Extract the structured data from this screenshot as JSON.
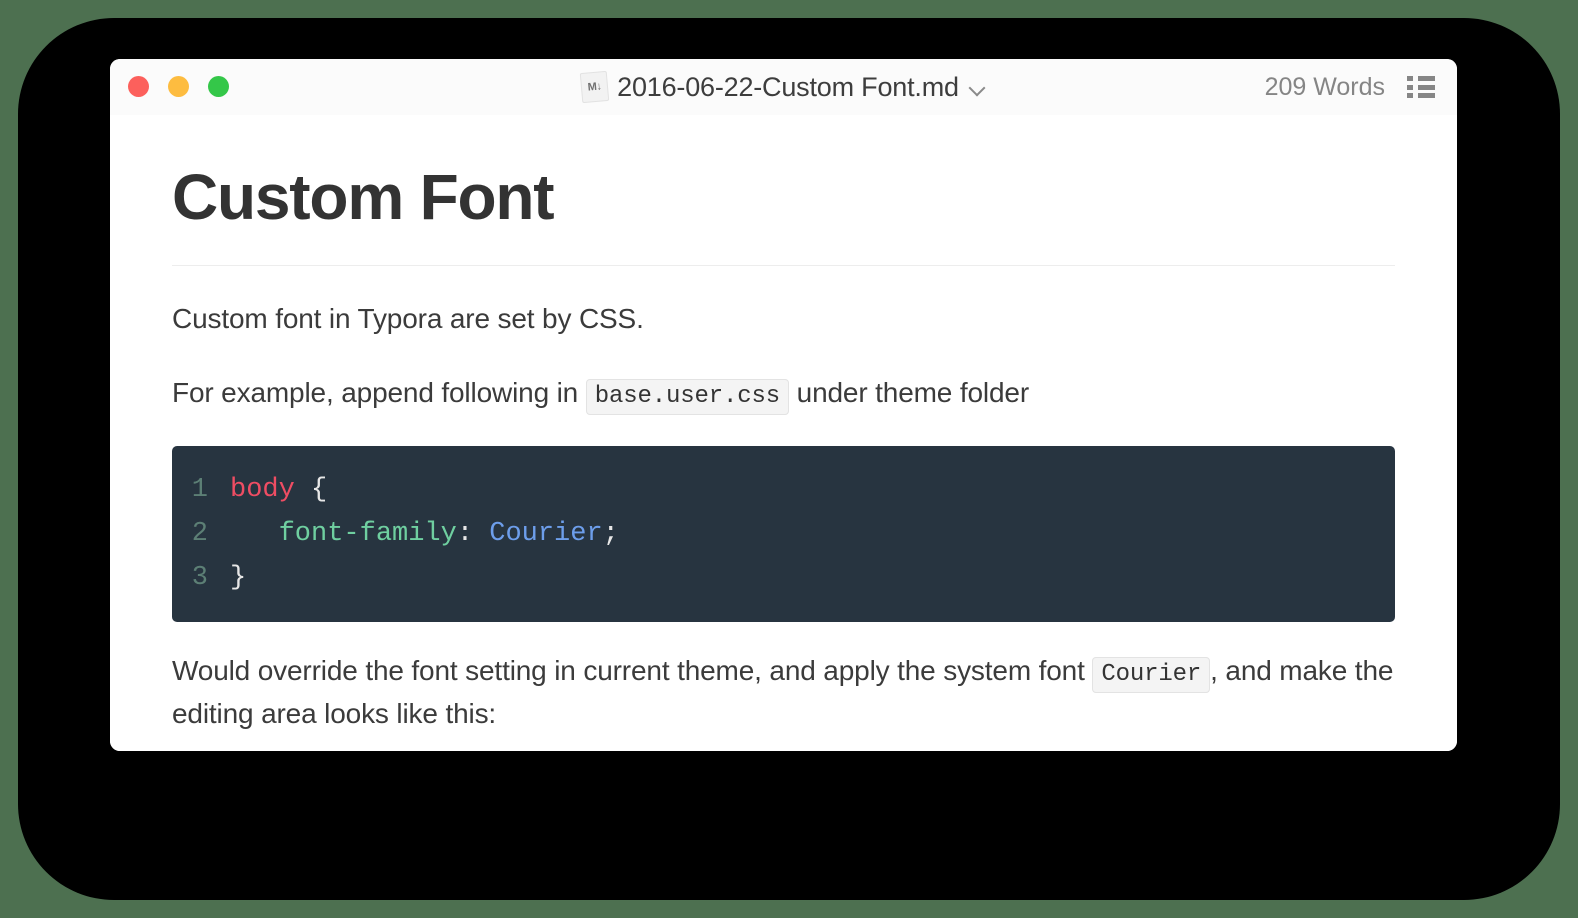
{
  "window": {
    "background_color": "#4d7050",
    "chrome_color": "#000000",
    "surface_color": "#ffffff"
  },
  "title_bar": {
    "traffic_lights": [
      {
        "name": "close",
        "color": "#fc605c"
      },
      {
        "name": "minimize",
        "color": "#fdbc40"
      },
      {
        "name": "maximize",
        "color": "#34c749"
      }
    ],
    "file_icon_label": "M↓",
    "document_title": "2016-06-22-Custom Font.md",
    "chevron_icon": "chevron-down-icon",
    "word_count": "209 Words",
    "outline_icon": "outline-list-icon"
  },
  "document": {
    "heading": "Custom Font",
    "paragraph_1": "Custom font in Typora are set by CSS.",
    "paragraph_2": {
      "before": "For example, append following in ",
      "code": "base.user.css",
      "after": " under theme folder"
    },
    "code_block": {
      "language": "css",
      "theme_background": "#273440",
      "lines": [
        {
          "number": "1",
          "tokens": [
            {
              "text": "body",
              "type": "selector",
              "color": "#ef4d63"
            },
            {
              "text": " {",
              "type": "punct",
              "color": "#e7e7e7"
            }
          ]
        },
        {
          "number": "2",
          "tokens": [
            {
              "text": "   font-family",
              "type": "property",
              "color": "#6fcfa0"
            },
            {
              "text": ": ",
              "type": "punct",
              "color": "#e7e7e7"
            },
            {
              "text": "Courier",
              "type": "value",
              "color": "#6d9eeb"
            },
            {
              "text": ";",
              "type": "punct",
              "color": "#e7e7e7"
            }
          ]
        },
        {
          "number": "3",
          "tokens": [
            {
              "text": "}",
              "type": "punct",
              "color": "#e7e7e7"
            }
          ]
        }
      ]
    },
    "paragraph_3": {
      "before": "Would override the font setting in current theme, and apply the system font ",
      "code": "Courier",
      "after": ", and make the editing area looks like this:"
    }
  }
}
